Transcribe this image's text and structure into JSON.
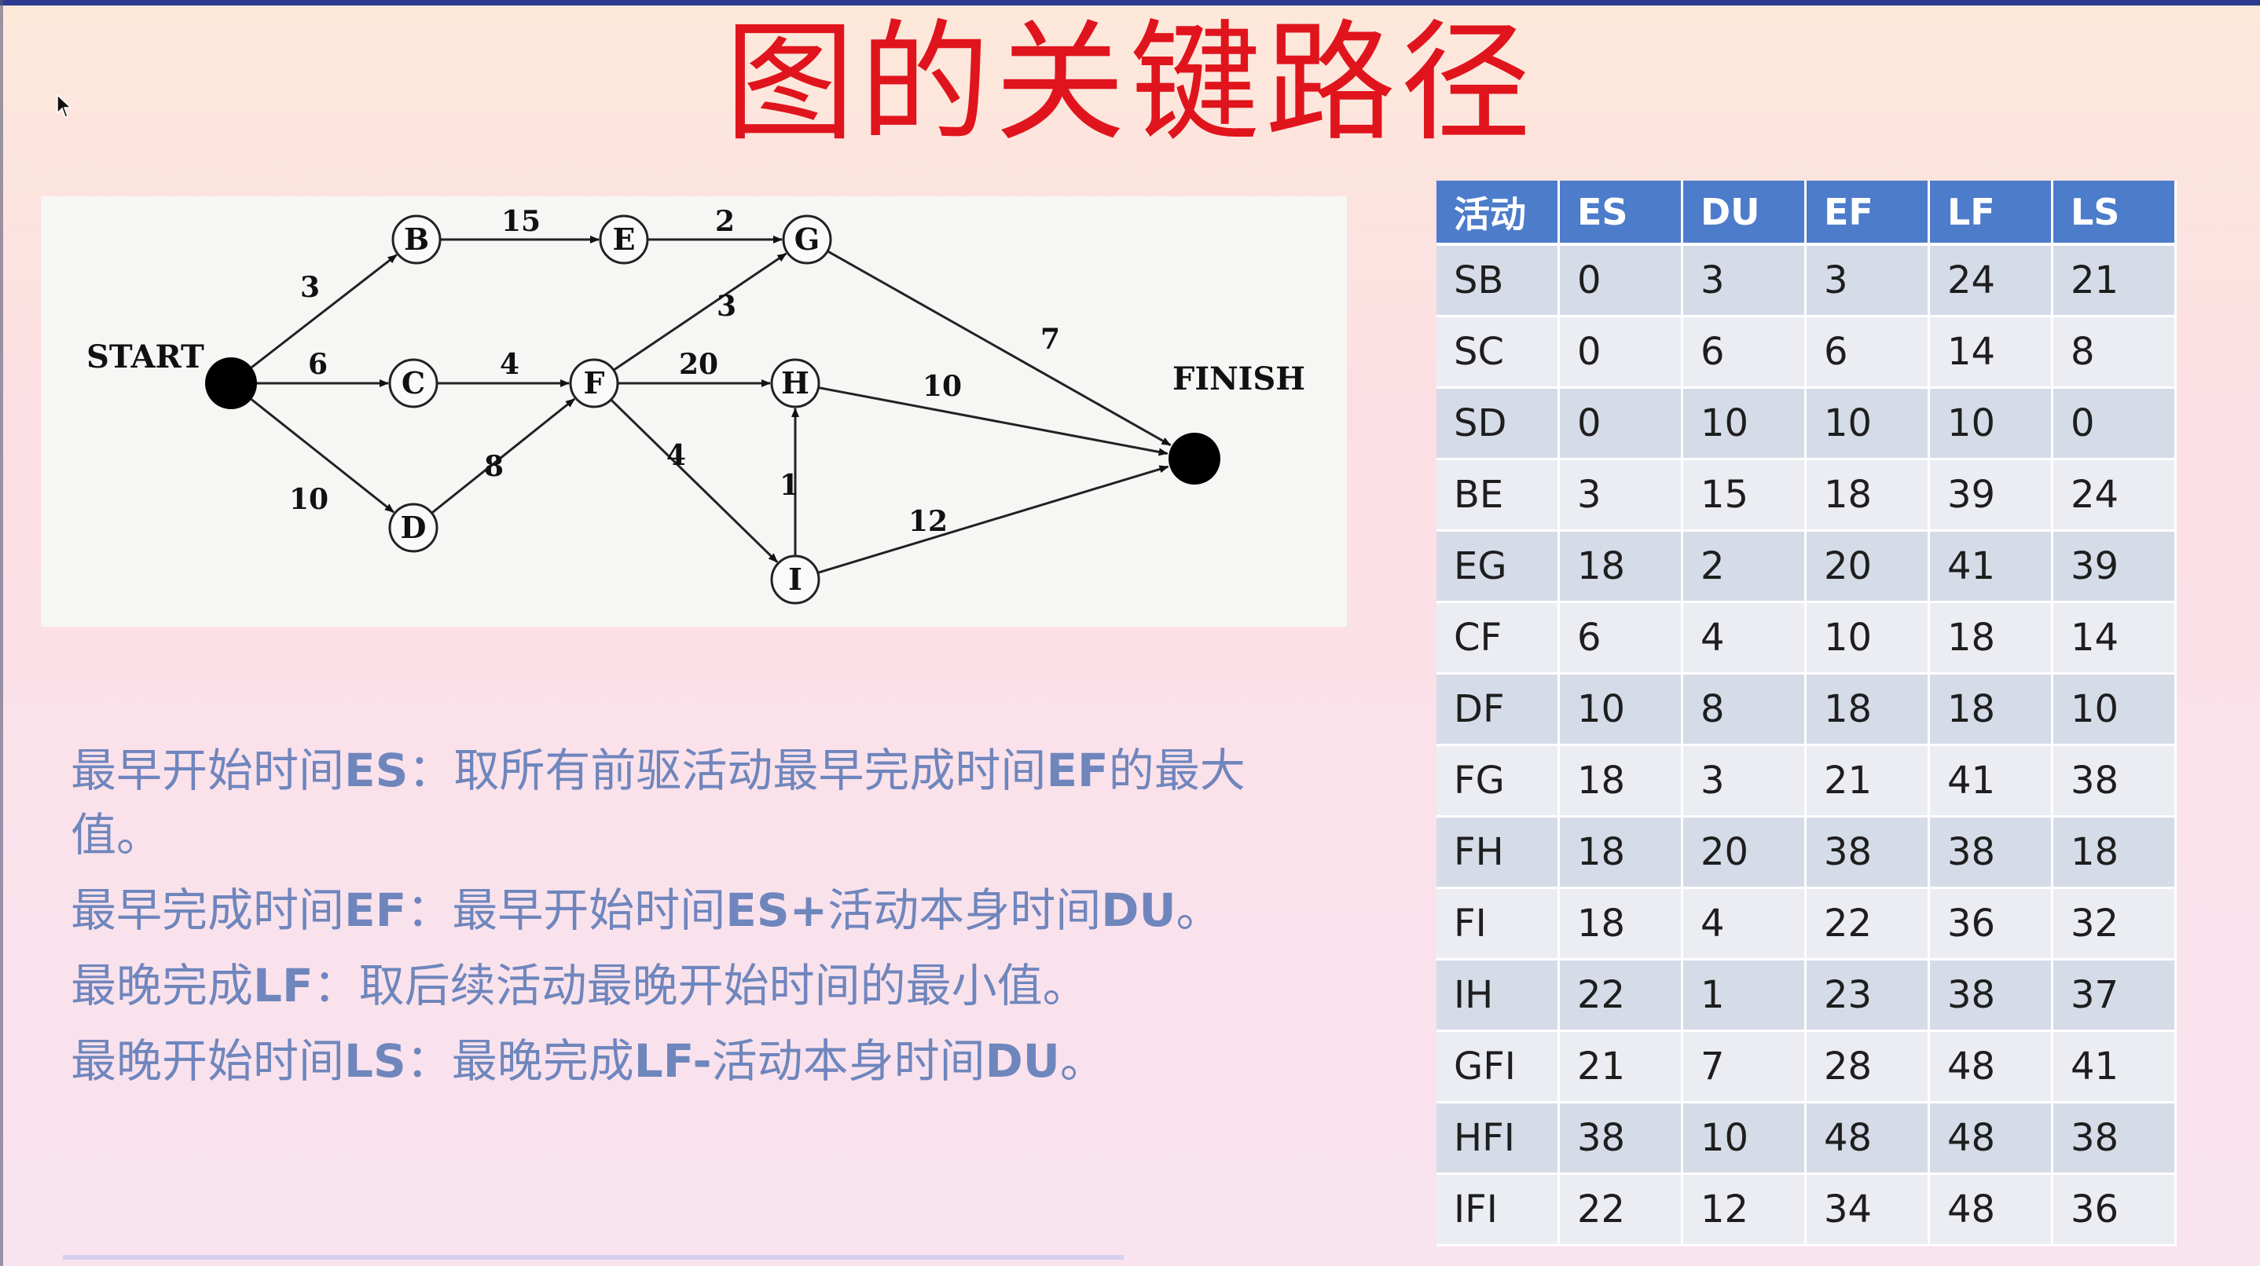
{
  "title": "图的关键路径",
  "network": {
    "start_label": "START",
    "finish_label": "FINISH",
    "nodes": [
      "B",
      "C",
      "D",
      "E",
      "F",
      "G",
      "H",
      "I"
    ],
    "edges": [
      {
        "from": "START",
        "to": "B",
        "weight": "3"
      },
      {
        "from": "START",
        "to": "C",
        "weight": "6"
      },
      {
        "from": "START",
        "to": "D",
        "weight": "10"
      },
      {
        "from": "B",
        "to": "E",
        "weight": "15"
      },
      {
        "from": "E",
        "to": "G",
        "weight": "2"
      },
      {
        "from": "C",
        "to": "F",
        "weight": "4"
      },
      {
        "from": "D",
        "to": "F",
        "weight": "8"
      },
      {
        "from": "F",
        "to": "G",
        "weight": "3"
      },
      {
        "from": "F",
        "to": "H",
        "weight": "20"
      },
      {
        "from": "F",
        "to": "I",
        "weight": "4"
      },
      {
        "from": "I",
        "to": "H",
        "weight": "1"
      },
      {
        "from": "G",
        "to": "FINISH",
        "weight": "7"
      },
      {
        "from": "H",
        "to": "FINISH",
        "weight": "10"
      },
      {
        "from": "I",
        "to": "FINISH",
        "weight": "12"
      }
    ]
  },
  "rules": [
    {
      "pre": "最早开始时间",
      "key": "ES",
      "mid": "：取所有前驱活动最早完成时间",
      "key2": "EF",
      "post": "的最大值。"
    },
    {
      "pre": "最早完成时间",
      "key": "EF",
      "mid": "：最早开始时间",
      "key2": "ES+",
      "post": "活动本身时间",
      "key3": "DU",
      "end": "。"
    },
    {
      "pre": "最晚完成",
      "key": "LF",
      "mid": "：取后续活动最晚开始时间的最小值。"
    },
    {
      "pre": "最晚开始时间",
      "key": "LS",
      "mid": "：最晚完成",
      "key2": "LF-",
      "post": "活动本身时间",
      "key3": "DU",
      "end": "。"
    }
  ],
  "table": {
    "headers": [
      "活动",
      "ES",
      "DU",
      "EF",
      "LF",
      "LS"
    ],
    "rows": [
      [
        "SB",
        "0",
        "3",
        "3",
        "24",
        "21"
      ],
      [
        "SC",
        "0",
        "6",
        "6",
        "14",
        "8"
      ],
      [
        "SD",
        "0",
        "10",
        "10",
        "10",
        "0"
      ],
      [
        "BE",
        "3",
        "15",
        "18",
        "39",
        "24"
      ],
      [
        "EG",
        "18",
        "2",
        "20",
        "41",
        "39"
      ],
      [
        "CF",
        "6",
        "4",
        "10",
        "18",
        "14"
      ],
      [
        "DF",
        "10",
        "8",
        "18",
        "18",
        "10"
      ],
      [
        "FG",
        "18",
        "3",
        "21",
        "41",
        "38"
      ],
      [
        "FH",
        "18",
        "20",
        "38",
        "38",
        "18"
      ],
      [
        "FI",
        "18",
        "4",
        "22",
        "36",
        "32"
      ],
      [
        "IH",
        "22",
        "1",
        "23",
        "38",
        "37"
      ],
      [
        "GFI",
        "21",
        "7",
        "28",
        "48",
        "41"
      ],
      [
        "HFI",
        "38",
        "10",
        "48",
        "48",
        "38"
      ],
      [
        "IFI",
        "22",
        "12",
        "34",
        "48",
        "36"
      ]
    ]
  },
  "colors": {
    "title": "#e0141c",
    "header": "#4d7ccb",
    "rule_text": "#6f86bd"
  },
  "icons": {
    "cursor": "mouse-pointer-icon"
  }
}
